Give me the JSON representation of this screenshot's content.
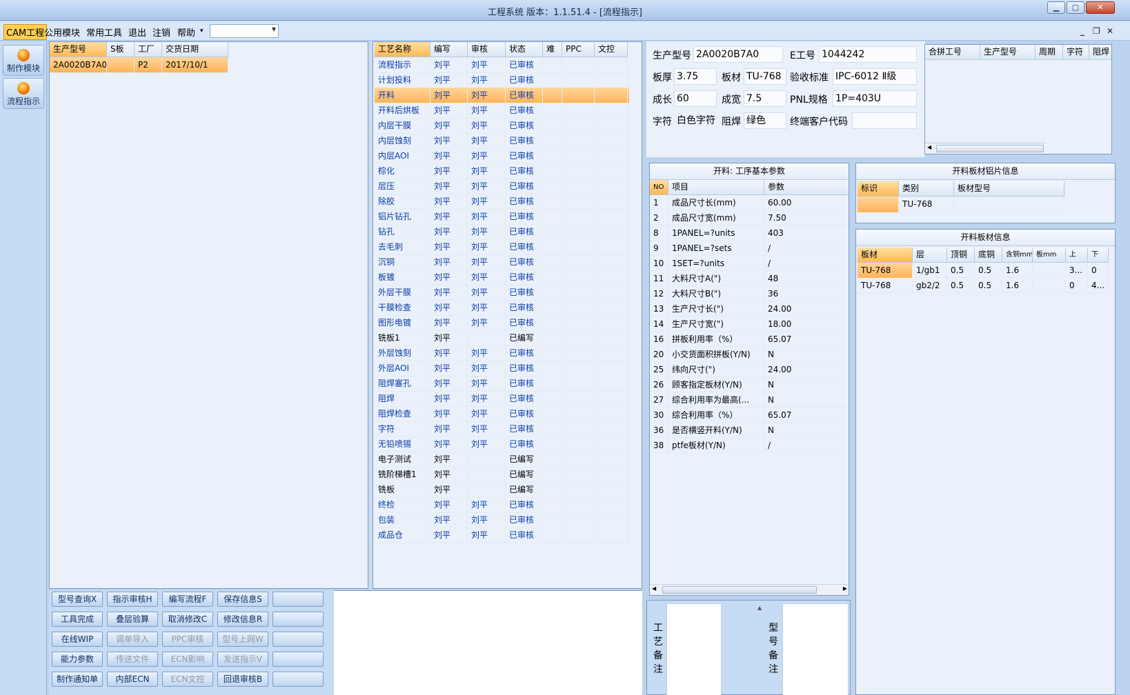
{
  "window": {
    "title": "工程系统   版本：1.1.51.4 - [流程指示]",
    "min": "▁",
    "max": "▢",
    "close": "✕"
  },
  "menu": {
    "items": [
      "CAM工程",
      "公用模块",
      "常用工具",
      "退出",
      "注销",
      "帮助"
    ],
    "help_arrow": "▾",
    "combo_value": "",
    "mdi_min": "_",
    "mdi_restore": "❐",
    "mdi_close": "✕"
  },
  "nav": [
    {
      "label": "制作模块",
      "icon": "fire-icon"
    },
    {
      "label": "流程指示",
      "icon": "pause-icon"
    }
  ],
  "job_table": {
    "headers": [
      "生产型号",
      "S板",
      "工厂",
      "交货日期"
    ],
    "rows": [
      [
        "2A0020B7A0",
        "",
        "P2",
        "2017/10/1"
      ]
    ]
  },
  "process_table": {
    "headers": [
      "工艺名称",
      "编写",
      "审核",
      "状态",
      "难",
      "PPC",
      "文控"
    ],
    "selected_index": 2,
    "rows": [
      [
        "流程指示",
        "刘平",
        "刘平",
        "已审核"
      ],
      [
        "计划投料",
        "刘平",
        "刘平",
        "已审核"
      ],
      [
        "开料",
        "刘平",
        "刘平",
        "已审核"
      ],
      [
        "开料后烘板",
        "刘平",
        "刘平",
        "已审核"
      ],
      [
        "内层干膜",
        "刘平",
        "刘平",
        "已审核"
      ],
      [
        "内层蚀刻",
        "刘平",
        "刘平",
        "已审核"
      ],
      [
        "内层AOI",
        "刘平",
        "刘平",
        "已审核"
      ],
      [
        "棕化",
        "刘平",
        "刘平",
        "已审核"
      ],
      [
        "层压",
        "刘平",
        "刘平",
        "已审核"
      ],
      [
        "除胶",
        "刘平",
        "刘平",
        "已审核"
      ],
      [
        "铝片钻孔",
        "刘平",
        "刘平",
        "已审核"
      ],
      [
        "钻孔",
        "刘平",
        "刘平",
        "已审核"
      ],
      [
        "去毛刺",
        "刘平",
        "刘平",
        "已审核"
      ],
      [
        "沉铜",
        "刘平",
        "刘平",
        "已审核"
      ],
      [
        "板镀",
        "刘平",
        "刘平",
        "已审核"
      ],
      [
        "外层干膜",
        "刘平",
        "刘平",
        "已审核"
      ],
      [
        "干膜检查",
        "刘平",
        "刘平",
        "已审核"
      ],
      [
        "图形电镀",
        "刘平",
        "刘平",
        "已审核"
      ],
      [
        "铣板1",
        "刘平",
        "",
        "已编写"
      ],
      [
        "外层蚀刻",
        "刘平",
        "刘平",
        "已审核"
      ],
      [
        "外层AOI",
        "刘平",
        "刘平",
        "已审核"
      ],
      [
        "阻焊塞孔",
        "刘平",
        "刘平",
        "已审核"
      ],
      [
        "阻焊",
        "刘平",
        "刘平",
        "已审核"
      ],
      [
        "阻焊检查",
        "刘平",
        "刘平",
        "已审核"
      ],
      [
        "字符",
        "刘平",
        "刘平",
        "已审核"
      ],
      [
        "无铅喷锡",
        "刘平",
        "刘平",
        "已审核"
      ],
      [
        "电子测试",
        "刘平",
        "",
        "已编写"
      ],
      [
        "铣阶梯槽1",
        "刘平",
        "",
        "已编写"
      ],
      [
        "铣板",
        "刘平",
        "",
        "已编写"
      ],
      [
        "终检",
        "刘平",
        "刘平",
        "已审核"
      ],
      [
        "包装",
        "刘平",
        "刘平",
        "已审核"
      ],
      [
        "成品仓",
        "刘平",
        "刘平",
        "已审核"
      ]
    ]
  },
  "info": {
    "model_label": "生产型号",
    "model": "2A0020B7A0",
    "e_label": "E工号",
    "e_no": "1044242",
    "thick_label": "板厚",
    "thick": "3.75",
    "mat_label": "板材",
    "mat": "TU-768",
    "std_label": "验收标准",
    "std": "IPC-6012 Ⅱ级",
    "len_label": "成长",
    "len": "60",
    "wid_label": "成宽",
    "wid": "7.5",
    "pnl_label": "PNL规格",
    "pnl": "1P=403U",
    "char_label": "字符",
    "char": "白色字符",
    "mask_label": "阻焊",
    "mask": "绿色",
    "cust_label": "终端客户代码",
    "cust": ""
  },
  "combine_table": {
    "headers": [
      "合拼工号",
      "生产型号",
      "周期",
      "字符",
      "阻焊"
    ]
  },
  "params": {
    "title": "开料: 工序基本参数",
    "headers": [
      "NO",
      "项目",
      "参数"
    ],
    "rows": [
      [
        "1",
        "成品尺寸长(mm)",
        "60.00"
      ],
      [
        "2",
        "成品尺寸宽(mm)",
        "7.50"
      ],
      [
        "8",
        "1PANEL=?units",
        "403"
      ],
      [
        "9",
        "1PANEL=?sets",
        "/"
      ],
      [
        "10",
        "1SET=?units",
        "/"
      ],
      [
        "11",
        "大料尺寸A(\")",
        "48"
      ],
      [
        "12",
        "大料尺寸B(\")",
        "36"
      ],
      [
        "13",
        "生产尺寸长(\")",
        "24.00"
      ],
      [
        "14",
        "生产尺寸宽(\")",
        "18.00"
      ],
      [
        "16",
        "拼板利用率（%）",
        "65.07"
      ],
      [
        "20",
        "小交货面积拼板(Y/N)",
        "N"
      ],
      [
        "25",
        "纬向尺寸(\")",
        "24.00"
      ],
      [
        "26",
        "顾客指定板材(Y/N)",
        "N"
      ],
      [
        "27",
        "综合利用率为最高(...",
        "N"
      ],
      [
        "30",
        "综合利用率（%）",
        "65.07"
      ],
      [
        "36",
        "是否横竖开料(Y/N)",
        "N"
      ],
      [
        "38",
        "ptfe板材(Y/N)",
        "/"
      ]
    ]
  },
  "alu_info": {
    "title": "开料板材铝片信息",
    "headers": [
      "标识",
      "类别",
      "板材型号"
    ],
    "rows": [
      [
        "",
        "TU-768",
        ""
      ]
    ]
  },
  "mat_info": {
    "title": "开料板材信息",
    "headers": [
      "板材",
      "层",
      "顶铜",
      "底铜",
      "含铜mm",
      "板mm",
      "上",
      "下"
    ],
    "rows": [
      [
        "TU-768",
        "1/gb1",
        "0.5",
        "0.5",
        "1.6",
        "",
        "3...",
        "0"
      ],
      [
        "TU-768",
        "gb2/2",
        "0.5",
        "0.5",
        "1.6",
        "",
        "0",
        "4..."
      ]
    ]
  },
  "remarks": {
    "process": "工艺备注",
    "model": "型号备注"
  },
  "buttons": [
    [
      "型号查询X",
      "指示审核H",
      "编写流程F",
      "保存信息S",
      ""
    ],
    [
      "工具完成",
      "叠层验算",
      "取消修改C",
      "修改信息R",
      ""
    ],
    [
      "在线WIP",
      "调单导入",
      "PPC审核",
      "型号上网W",
      ""
    ],
    [
      "能力参数",
      "传送文件",
      "ECN影响",
      "发送指示V",
      ""
    ],
    [
      "制作通知单",
      "内部ECN",
      "ECN文控",
      "回退审核B",
      ""
    ]
  ],
  "disabled_buttons": [
    "调单导入",
    "PPC审核",
    "型号上网W",
    "传送文件",
    "ECN影响",
    "发送指示V",
    "ECN文控"
  ],
  "colors": {
    "selected": "#ffb357",
    "blue_text": "#0b3aa8",
    "background": "#bcd3ef"
  }
}
